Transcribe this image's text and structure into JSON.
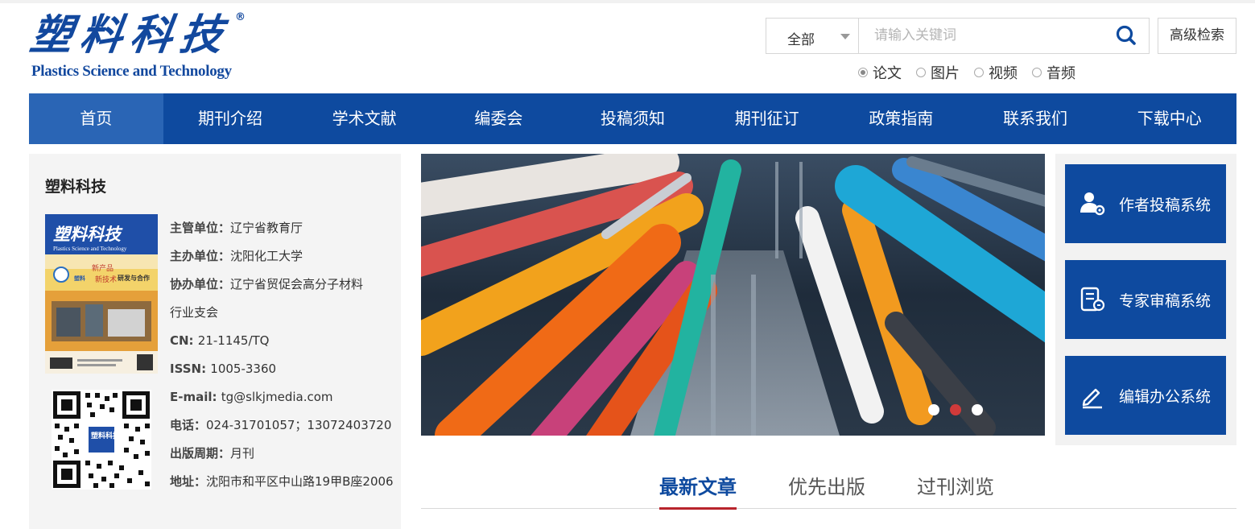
{
  "logo": {
    "cn": "塑料科技",
    "en": "Plastics Science and Technology",
    "reg": "®"
  },
  "search": {
    "scope": "全部",
    "placeholder": "请输入关键词",
    "advanced_label": "高级检索",
    "types": [
      {
        "label": "论文",
        "checked": true
      },
      {
        "label": "图片",
        "checked": false
      },
      {
        "label": "视频",
        "checked": false
      },
      {
        "label": "音频",
        "checked": false
      }
    ]
  },
  "nav": [
    {
      "label": "首页",
      "active": true
    },
    {
      "label": "期刊介绍"
    },
    {
      "label": "学术文献"
    },
    {
      "label": "编委会"
    },
    {
      "label": "投稿须知"
    },
    {
      "label": "期刊征订"
    },
    {
      "label": "政策指南"
    },
    {
      "label": "联系我们"
    },
    {
      "label": "下载中心"
    }
  ],
  "journal": {
    "name": "塑料科技",
    "fields": [
      {
        "label": "主管单位：",
        "value": "辽宁省教育厅"
      },
      {
        "label": "主办单位：",
        "value": "沈阳化工大学"
      },
      {
        "label": "协办单位：",
        "value": "辽宁省贸促会高分子材料"
      },
      {
        "label": "",
        "value": "行业支会"
      },
      {
        "label": "CN: ",
        "value": "21-1145/TQ"
      },
      {
        "label": "ISSN: ",
        "value": "1005-3360"
      },
      {
        "label": "E-mail: ",
        "value": "tg@slkjmedia.com"
      },
      {
        "label": "电话：",
        "value": "024-31701057；13072403720"
      },
      {
        "label": "出版周期：",
        "value": "月刊"
      },
      {
        "label": "地址：",
        "value": "沈阳市和平区中山路19甲B座2006"
      }
    ],
    "cover": {
      "title": "塑料科技",
      "subtitle": "Plastics Science and Technology",
      "slogan_1": "新产品",
      "slogan_2": "新技术",
      "slogan_3": "研发与合作",
      "brand": "塑料"
    },
    "qr_label": "塑料科技"
  },
  "banner": {
    "slide_count": 3,
    "active_slide": 1
  },
  "systems": [
    {
      "label": "作者投稿系统",
      "icon": "author-icon"
    },
    {
      "label": "专家审稿系统",
      "icon": "review-icon"
    },
    {
      "label": "编辑办公系统",
      "icon": "edit-icon"
    }
  ],
  "tabs": [
    {
      "label": "最新文章",
      "active": true
    },
    {
      "label": "优先出版"
    },
    {
      "label": "过刊浏览"
    }
  ],
  "colors": {
    "brand": "#0e4a9f",
    "nav_active": "#2a65b5",
    "accent": "#b8242c"
  }
}
